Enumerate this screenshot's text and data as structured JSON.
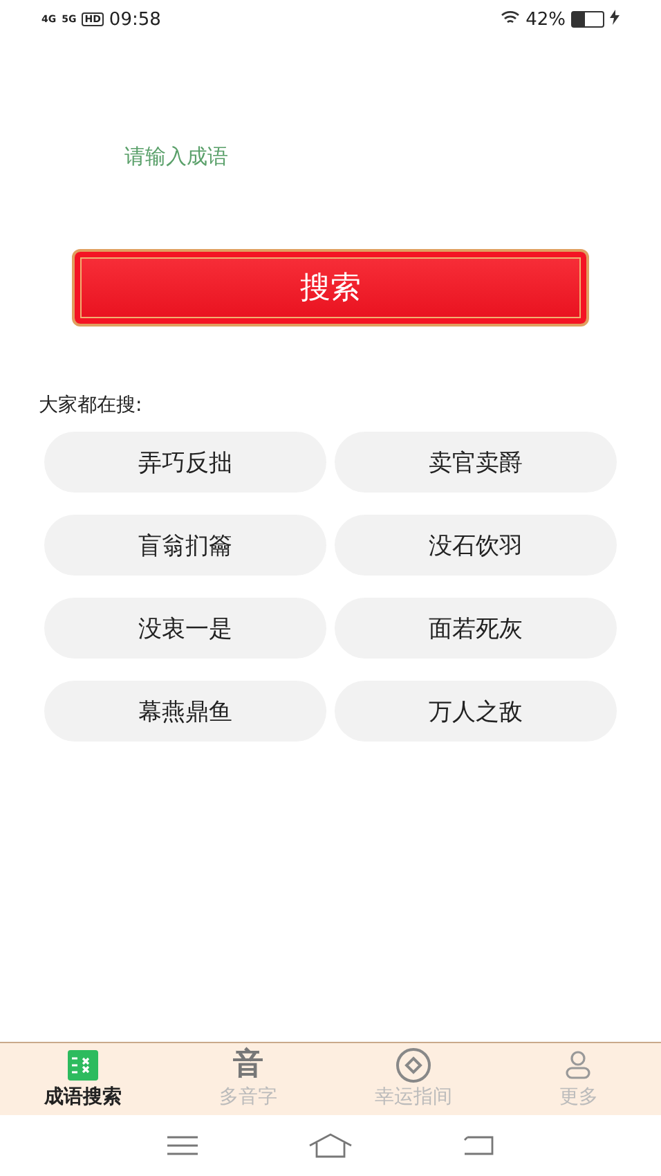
{
  "status_bar": {
    "net1": "4G",
    "net2": "5G",
    "hd": "HD",
    "time": "09:58",
    "battery": "42%"
  },
  "search": {
    "placeholder": "请输入成语",
    "button": "搜索"
  },
  "popular": {
    "title": "大家都在搜:",
    "items": [
      "弄巧反拙",
      "卖官卖爵",
      "盲翁扪籥",
      "没石饮羽",
      "没衷一是",
      "面若死灰",
      "幕燕鼎鱼",
      "万人之敌"
    ]
  },
  "tabs": [
    {
      "label": "成语搜索",
      "kind": "list",
      "selected": true
    },
    {
      "label": "多音字",
      "kind": "char",
      "glyph": "音",
      "selected": false
    },
    {
      "label": "幸运指间",
      "kind": "coin",
      "selected": false
    },
    {
      "label": "更多",
      "kind": "person",
      "selected": false
    }
  ]
}
